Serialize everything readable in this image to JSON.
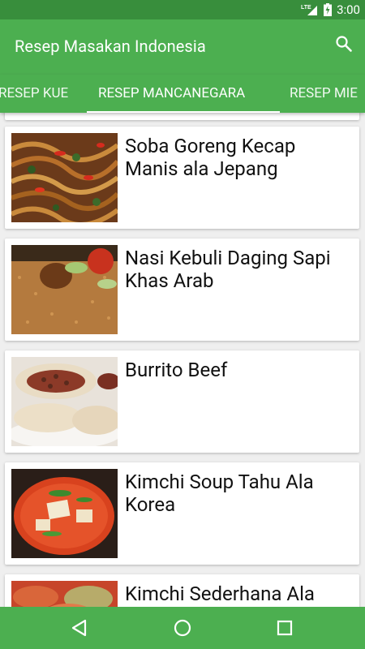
{
  "status_bar": {
    "network": "LTE",
    "time": "3:00"
  },
  "app_bar": {
    "title": "Resep Masakan Indonesia",
    "search_icon": "search-icon"
  },
  "tabs": [
    {
      "label": "RESEP KUE"
    },
    {
      "label": "RESEP MANCANEGARA"
    },
    {
      "label": "RESEP MIE"
    }
  ],
  "recipes": [
    {
      "name": "Soba Goreng Kecap Manis ala Jepang"
    },
    {
      "name": "Nasi Kebuli Daging Sapi Khas Arab"
    },
    {
      "name": "Burrito Beef"
    },
    {
      "name": "Kimchi Soup Tahu Ala Korea"
    },
    {
      "name": "Kimchi Sederhana Ala"
    }
  ],
  "colors": {
    "primary": "#4caf50",
    "primary_dark": "#388e3c",
    "background": "#efefef"
  }
}
